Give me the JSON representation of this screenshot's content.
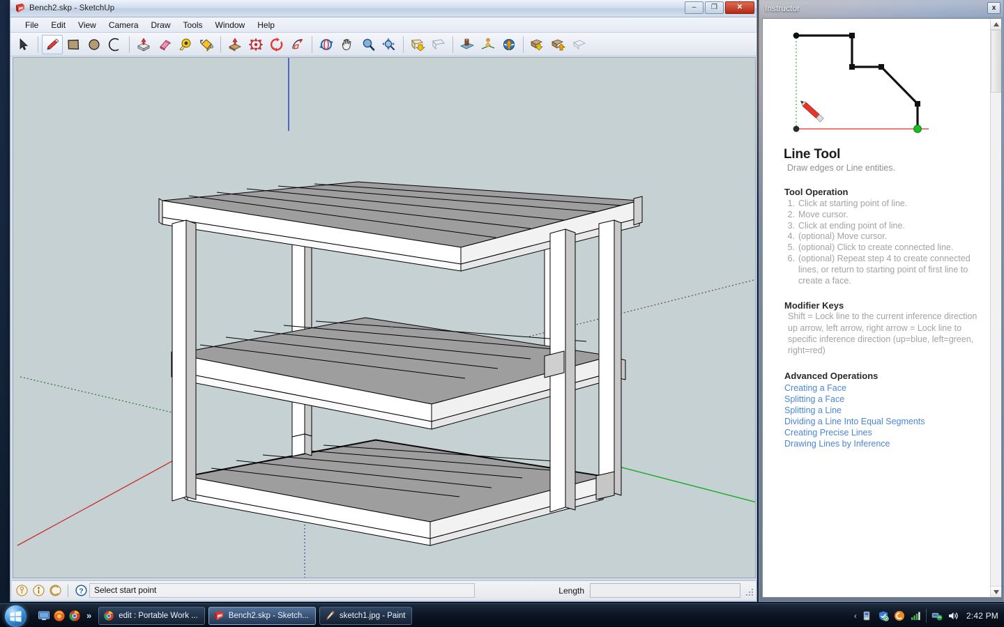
{
  "window": {
    "title": "Bench2.skp - SketchUp",
    "app_icon": "sketchup-icon",
    "controls": {
      "minimize": "–",
      "maximize": "❐",
      "close": "✕"
    }
  },
  "menubar": {
    "items": [
      "File",
      "Edit",
      "View",
      "Camera",
      "Draw",
      "Tools",
      "Window",
      "Help"
    ]
  },
  "toolbar": {
    "groups": [
      {
        "tools": [
          {
            "name": "select-tool",
            "label": "Select"
          }
        ]
      },
      {
        "tools": [
          {
            "name": "line-tool",
            "label": "Line",
            "active": true
          },
          {
            "name": "rectangle-tool",
            "label": "Rectangle"
          },
          {
            "name": "circle-tool",
            "label": "Circle"
          },
          {
            "name": "arc-tool",
            "label": "Arc"
          }
        ]
      },
      {
        "tools": [
          {
            "name": "pushpull-tool",
            "label": "Push/Pull"
          },
          {
            "name": "eraser-tool",
            "label": "Eraser"
          },
          {
            "name": "tape-measure-tool",
            "label": "Tape Measure"
          },
          {
            "name": "paint-bucket-tool",
            "label": "Paint Bucket"
          }
        ]
      },
      {
        "tools": [
          {
            "name": "move-tool",
            "label": "Move"
          },
          {
            "name": "scale-tool",
            "label": "Scale"
          },
          {
            "name": "rotate-tool",
            "label": "Rotate"
          },
          {
            "name": "follow-me-tool",
            "label": "Follow Me"
          }
        ]
      },
      {
        "tools": [
          {
            "name": "orbit-tool",
            "label": "Orbit"
          },
          {
            "name": "pan-tool",
            "label": "Pan"
          },
          {
            "name": "zoom-tool",
            "label": "Zoom"
          },
          {
            "name": "zoom-extents-tool",
            "label": "Zoom Extents"
          }
        ]
      },
      {
        "tools": [
          {
            "name": "previous-view-tool",
            "label": "Previous"
          },
          {
            "name": "next-view-tool",
            "label": "Next"
          }
        ]
      },
      {
        "tools": [
          {
            "name": "position-camera-tool",
            "label": "Position Camera"
          },
          {
            "name": "walk-tool",
            "label": "Walk"
          },
          {
            "name": "look-around-tool",
            "label": "Look Around"
          }
        ]
      },
      {
        "tools": [
          {
            "name": "get-models-tool",
            "label": "Get Models"
          },
          {
            "name": "share-model-tool",
            "label": "Share Model"
          },
          {
            "name": "model-info-tool",
            "label": "Model Info"
          }
        ]
      }
    ]
  },
  "canvas": {
    "background_color": "#c5d1d2",
    "model_name": "workbench-3-shelf",
    "axis_colors": {
      "red": "#cc2b2b",
      "green": "#1eaa28",
      "blue": "#2b3fcc"
    },
    "face_colors": {
      "front": "#ffffff",
      "side": "#c8c8c8",
      "top": "#9e9e9e",
      "edge": "#000000"
    }
  },
  "statusbar": {
    "icons": [
      "protractor-icon",
      "credits-icon",
      "arcs-icon",
      "help-icon"
    ],
    "status_text": "Select start point",
    "measurement_label": "Length",
    "measurement_value": ""
  },
  "instructor": {
    "panel_title": "Instructor",
    "close_label": "x",
    "figure_name": "line-tool-illustration",
    "heading": "Line Tool",
    "subheading": "Draw edges or Line entities.",
    "sections": [
      {
        "title": "Tool Operation",
        "type": "ordered",
        "items": [
          "Click at starting point of line.",
          "Move cursor.",
          "Click at ending point of line.",
          "(optional) Move cursor.",
          "(optional) Click to create connected line.",
          "(optional) Repeat step 4 to create connected lines, or return to starting point of first line to create a face."
        ]
      },
      {
        "title": "Modifier Keys",
        "type": "paragraphs",
        "items": [
          "Shift = Lock line to the current inference direction",
          "up arrow, left arrow, right arrow = Lock line to specific inference direction (up=blue, left=green, right=red)"
        ]
      },
      {
        "title": "Advanced Operations",
        "type": "links",
        "items": [
          "Creating a Face",
          "Splitting a Face",
          "Splitting a Line",
          "Dividing a Line Into Equal Segments",
          "Creating Precise Lines",
          "Drawing Lines by Inference"
        ]
      }
    ],
    "link_color": "#4a86d8"
  },
  "taskbar": {
    "start_label": "Start",
    "quick_launch": [
      "show-desktop-icon",
      "firefox-icon",
      "chrome-icon"
    ],
    "overflow_label": "»",
    "tasks": [
      {
        "icon": "chrome-icon",
        "label": "edit : Portable Work ..."
      },
      {
        "icon": "sketchup-icon",
        "label": "Bench2.skp - Sketch...",
        "active": true
      },
      {
        "icon": "paint-icon",
        "label": "sketch1.jpg - Paint"
      }
    ],
    "tray_chevron": "‹",
    "tray_icons": [
      "device-icon",
      "shield-icon",
      "antivirus-icon",
      "signal-icon",
      "network-icon",
      "volume-icon"
    ],
    "clock": "2:42 PM"
  }
}
